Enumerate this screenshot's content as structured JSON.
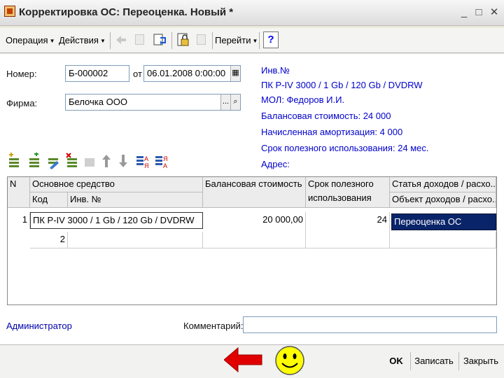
{
  "window": {
    "title": "Корректировка ОС: Переоценка. Новый *",
    "minimize": "_",
    "maximize": "□",
    "close": "✕"
  },
  "toolbar": {
    "operation_label": "Операция",
    "actions_label": "Действия",
    "goto_label": "Перейти",
    "help_label": "?",
    "icons": [
      "back-icon",
      "post-icon",
      "refresh-icon",
      "lock-icon",
      "unpost-icon"
    ]
  },
  "form": {
    "number_label": "Номер:",
    "number_value": "Б-000002",
    "from_label": "от",
    "date_value": "06.01.2008 0:00:00",
    "firm_label": "Фирма:",
    "firm_value": "Белочка ООО",
    "firm_btn": "...",
    "info": {
      "inv_label": "Инв.№",
      "item": "ПК P-IV 3000 / 1 Gb / 120 Gb / DVDRW",
      "mol": "МОЛ: Федоров И.И.",
      "balance": "Балансовая стоимость: 24 000",
      "amort": "Начисленная амортизация: 4 000",
      "term": "Срок полезного использования: 24 мес.",
      "address": "Адрес:"
    }
  },
  "table": {
    "headers": {
      "n": "N",
      "asset": "Основное средство",
      "code": "Код",
      "inv": "Инв. №",
      "balance": "Балансовая стоимость",
      "term1": "Срок полезного",
      "term2": "использования",
      "article": "Статья доходов / расхо...",
      "object": "Объект доходов / расхо..."
    },
    "rows": [
      {
        "n": "1",
        "asset": "ПК P-IV 3000 / 1 Gb / 120 Gb / DVDRW",
        "code": "2",
        "inv": "",
        "balance": "20 000,00",
        "term": "24",
        "article": "Переоценка ОС",
        "object": ""
      }
    ]
  },
  "bottom": {
    "user": "Администратор",
    "comment_label": "Комментарий:",
    "comment_value": ""
  },
  "footer": {
    "ok": "OK",
    "save": "Записать",
    "close": "Закрыть"
  },
  "colors": {
    "selection": "#0a246a",
    "info_text": "#0000cc",
    "arrow": "#e00000",
    "smiley": "#ffff00"
  }
}
